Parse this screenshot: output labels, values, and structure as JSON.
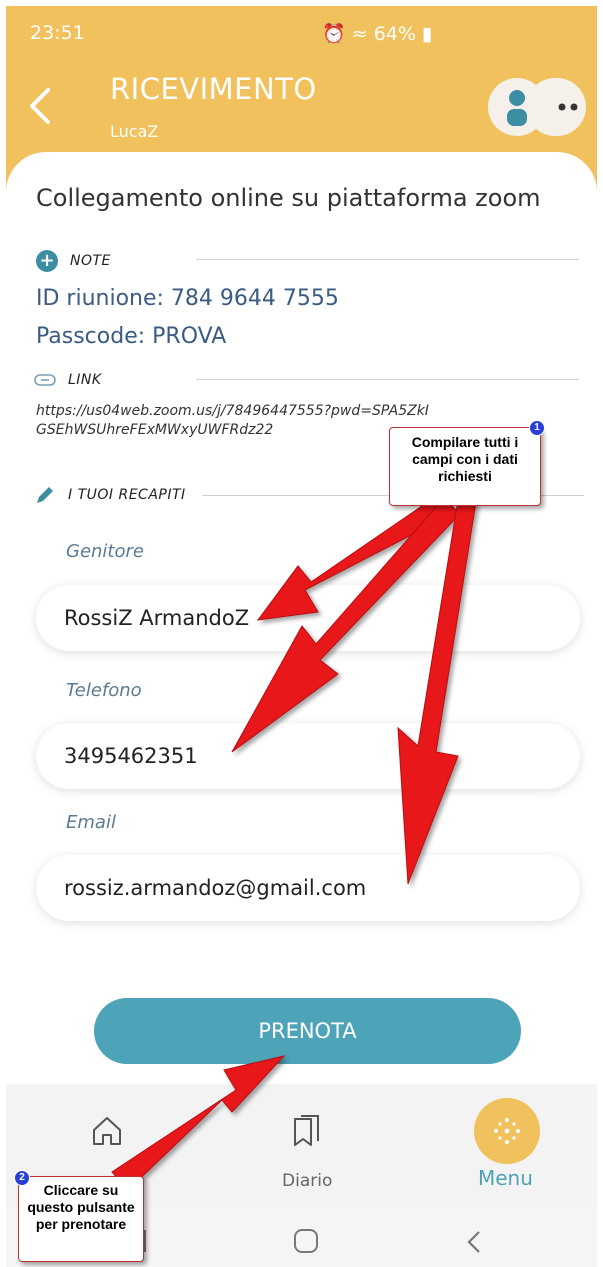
{
  "status_bar": {
    "time": "23:51",
    "battery": "64%"
  },
  "header": {
    "title": "RICEVIMENTO",
    "user": "LucaZ"
  },
  "content": {
    "top_text": "Collegamento online su piattaforma zoom",
    "note": {
      "label": "NOTE",
      "line1": "ID riunione: 784 9644 7555",
      "line2": "Passcode: PROVA"
    },
    "link": {
      "label": "LINK",
      "url": "https://us04web.zoom.us/j/78496447555?pwd=SPA5ZkIGSEhWSUhreFExMWxyUWFRdz22"
    },
    "contacts": {
      "label": "I TUOI RECAPITI",
      "fields": [
        {
          "label": "Genitore",
          "value": "RossiZ ArmandoZ"
        },
        {
          "label": "Telefono",
          "value": "3495462351"
        },
        {
          "label": "Email",
          "value": "rossiz.armandoz@gmail.com"
        }
      ]
    },
    "submit_label": "PRENOTA"
  },
  "nav": {
    "diario_label": "Diario",
    "menu_label": "Menu"
  },
  "annotations": {
    "callout1": {
      "badge": "1",
      "text": "Compilare tutti i campi con i dati richiesti"
    },
    "callout2": {
      "badge": "2",
      "text": "Cliccare su questo pulsante per prenotare"
    }
  },
  "colors": {
    "header": "#f0c15c",
    "accent": "#4da3b8",
    "note_text": "#3a5b83",
    "arrow": "#e8171a"
  }
}
